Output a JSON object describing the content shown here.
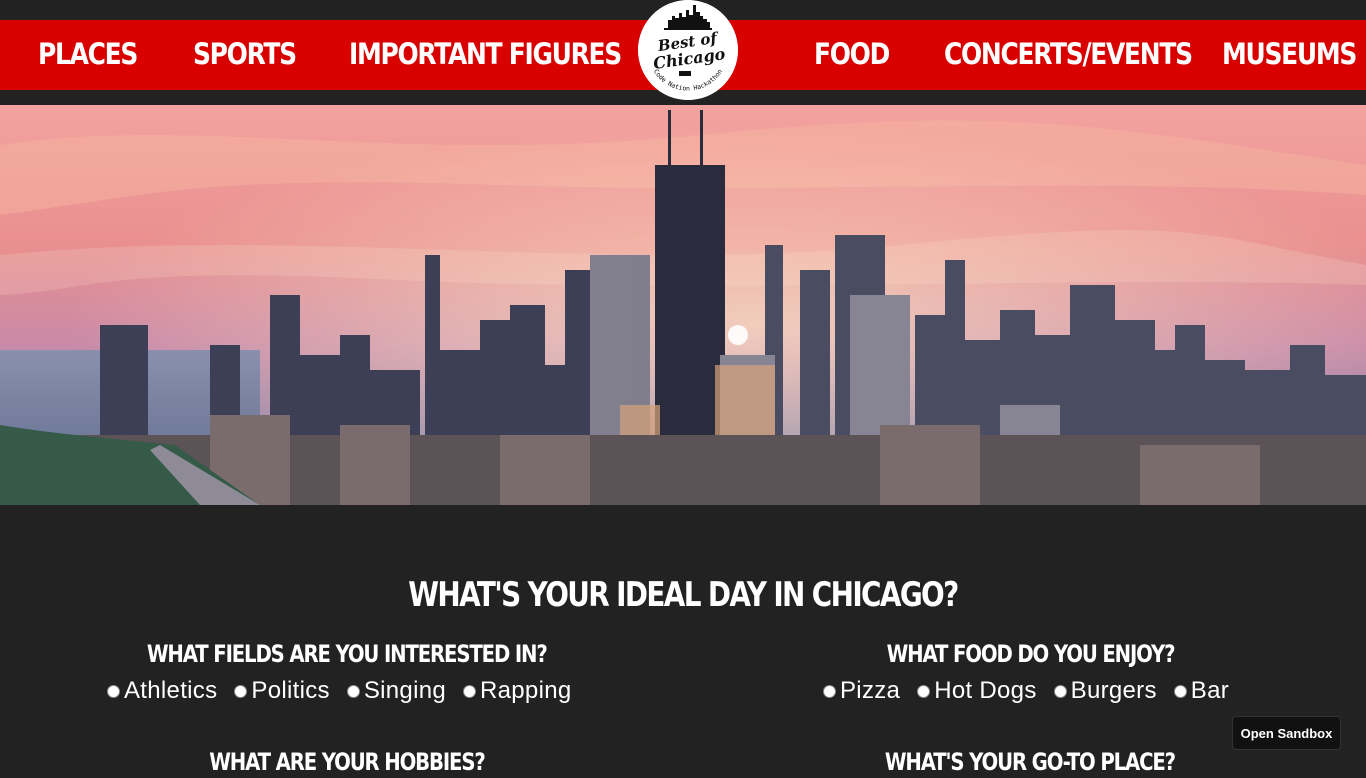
{
  "nav": {
    "left": [
      "PLACES",
      "SPORTS",
      "IMPORTANT FIGURES"
    ],
    "right": [
      "FOOD",
      "CONCERTS/EVENTS",
      "MUSEUMS"
    ]
  },
  "logo": {
    "text_line1": "Best of",
    "text_line2": "Chicago",
    "tagline": "Code Nation Hackathon"
  },
  "hero": {
    "image_semantic": "chicago-skyline-at-sunset-photo"
  },
  "quiz": {
    "title": "WHAT'S YOUR IDEAL DAY IN CHICAGO?",
    "questions": [
      {
        "title": "WHAT FIELDS ARE YOU INTERESTED IN?",
        "options": [
          "Athletics",
          "Politics",
          "Singing",
          "Rapping"
        ]
      },
      {
        "title": "WHAT FOOD DO YOU ENJOY?",
        "options": [
          "Pizza",
          "Hot Dogs",
          "Burgers",
          "Bar"
        ]
      },
      {
        "title": "WHAT ARE YOUR HOBBIES?",
        "options": []
      },
      {
        "title": "WHAT'S YOUR GO-TO PLACE?",
        "options": []
      }
    ]
  },
  "sandbox_button": "Open Sandbox",
  "colors": {
    "nav_red": "#d90000",
    "background": "#222222",
    "text": "#ffffff"
  }
}
